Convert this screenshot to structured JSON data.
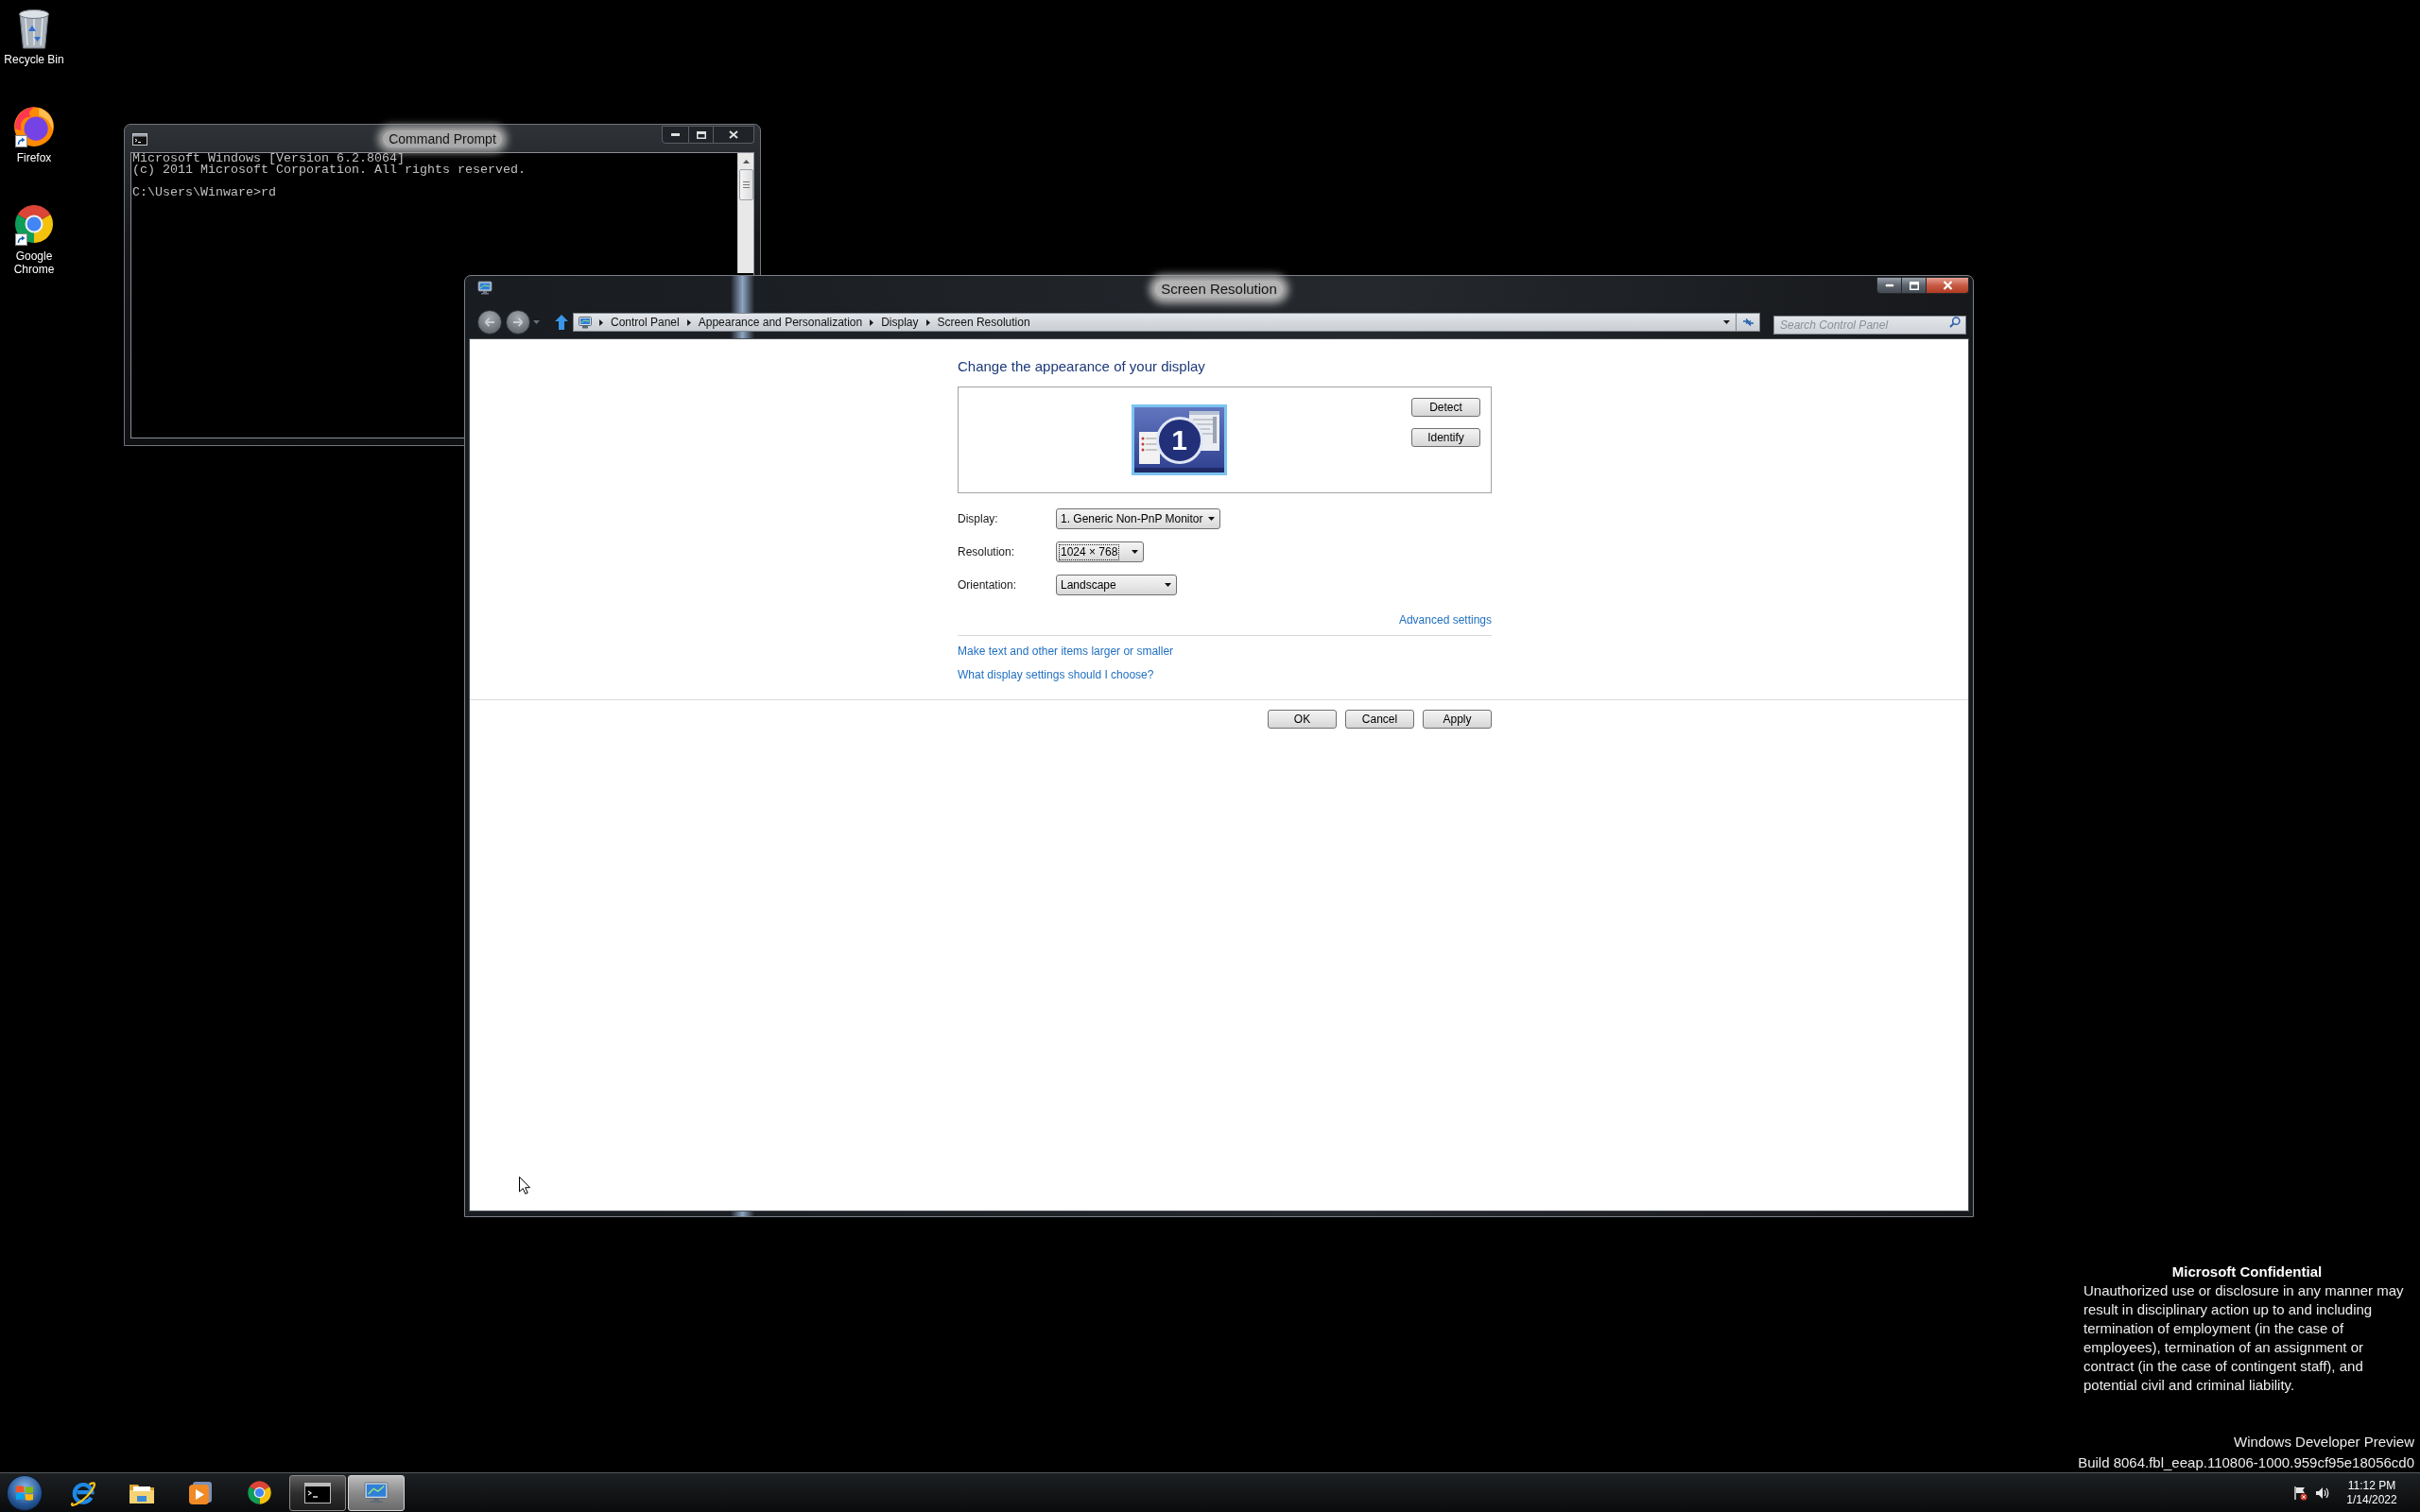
{
  "desktop": {
    "icons": [
      {
        "kind": "recycle_bin",
        "label": "Recycle Bin",
        "shortcut": false
      },
      {
        "kind": "firefox",
        "label": "Firefox",
        "shortcut": true
      },
      {
        "kind": "chrome",
        "label": "Google Chrome",
        "shortcut": true
      }
    ]
  },
  "command_prompt": {
    "title": "Command Prompt",
    "output_lines": [
      "Microsoft Windows [Version 6.2.8064]",
      "(c) 2011 Microsoft Corporation. All rights reserved."
    ],
    "prompt_line": "C:\\Users\\Winware>rd"
  },
  "screen_resolution": {
    "title": "Screen Resolution",
    "breadcrumb": [
      "Control Panel",
      "Appearance and Personalization",
      "Display",
      "Screen Resolution"
    ],
    "search": {
      "placeholder": "Search Control Panel"
    },
    "heading": "Change the appearance of your display",
    "monitors": [
      {
        "number": "1",
        "selected": true
      }
    ],
    "side_buttons": [
      "Detect",
      "Identify"
    ],
    "settings": [
      {
        "label": "Display:",
        "value": "1. Generic Non-PnP Monitor",
        "focused": false
      },
      {
        "label": "Resolution:",
        "value": "1024 × 768",
        "focused": true
      },
      {
        "label": "Orientation:",
        "value": "Landscape",
        "focused": false
      }
    ],
    "advanced_link": "Advanced settings",
    "help_links": [
      "Make text and other items larger or smaller",
      "What display settings should I choose?"
    ],
    "buttons": [
      "OK",
      "Cancel",
      "Apply"
    ]
  },
  "notice": {
    "title": "Microsoft Confidential",
    "text": "Unauthorized use or disclosure in any manner may result in disciplinary action up to and including termination of employment (in the case of employees), termination of an assignment or contract (in the case of contingent staff), and potential civil and criminal liability.",
    "edition": "Windows Developer Preview",
    "build": "Build 8064.fbl_eeap.110806-1000.959cf95e18056cd0"
  },
  "taskbar": {
    "apps": [
      {
        "kind": "internet_explorer",
        "running": false,
        "selected": false
      },
      {
        "kind": "file_explorer",
        "running": false,
        "selected": false
      },
      {
        "kind": "media_player",
        "running": false,
        "selected": false
      },
      {
        "kind": "chrome",
        "running": false,
        "selected": false
      },
      {
        "kind": "command_prompt",
        "running": true,
        "selected": false
      },
      {
        "kind": "control_panel",
        "running": true,
        "selected": true
      }
    ],
    "clock": {
      "time": "11:12 PM",
      "date": "1/14/2022"
    }
  }
}
